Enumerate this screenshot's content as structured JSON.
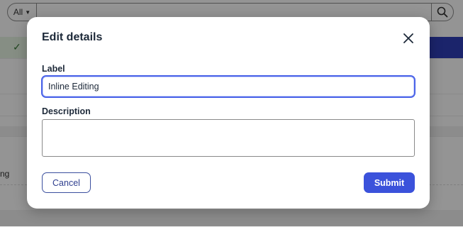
{
  "background": {
    "search_scope": "All",
    "row_fragment": "ng"
  },
  "dialog": {
    "title": "Edit details",
    "label_field": {
      "label": "Label",
      "value": "Inline Editing"
    },
    "description_field": {
      "label": "Description",
      "value": ""
    },
    "cancel_label": "Cancel",
    "submit_label": "Submit"
  },
  "icons": {
    "close": "close-icon",
    "search": "search-icon",
    "check": "check-icon",
    "caret": "caret-down-icon"
  },
  "colors": {
    "accent": "#3b52db",
    "focus_border": "#4a63e8",
    "title_text": "#1d2939"
  }
}
